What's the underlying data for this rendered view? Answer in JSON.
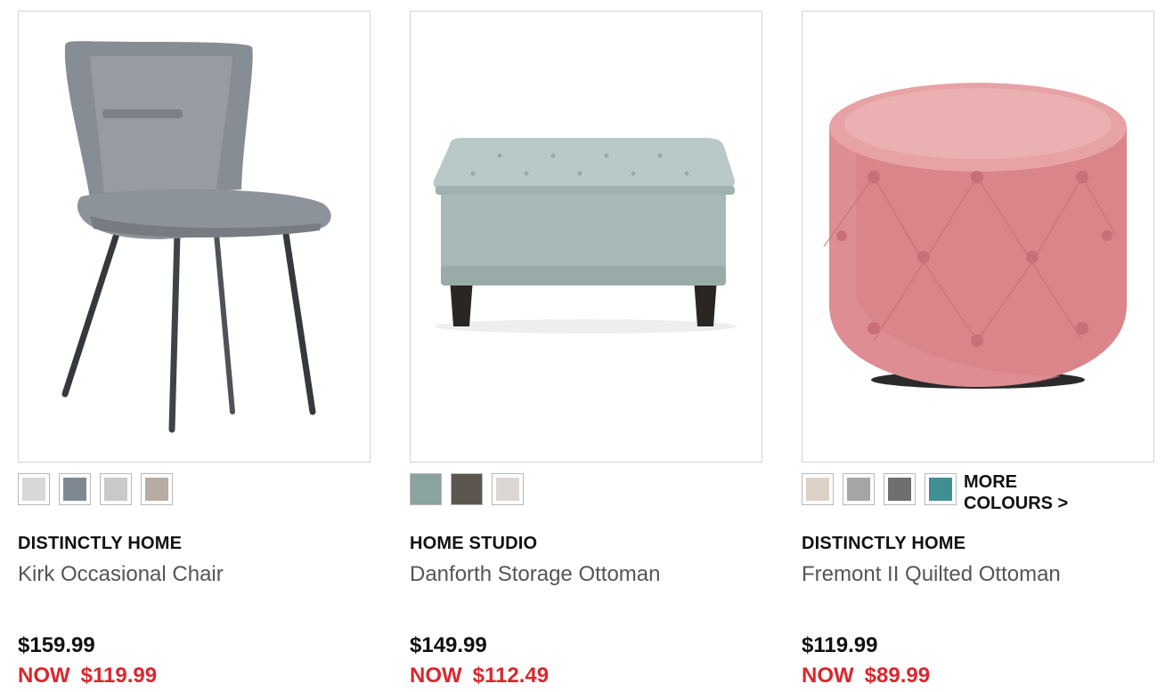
{
  "products": [
    {
      "brand": "DISTINCTLY HOME",
      "name": "Kirk Occasional Chair",
      "price": "$159.99",
      "now_label": "NOW",
      "sale_price": "$119.99",
      "image_icon": "grey-dining-chair",
      "swatches": [
        "#d8d8d8",
        "#7e8892",
        "#c9cac8",
        "#b7aca4"
      ],
      "more_colours": ""
    },
    {
      "brand": "HOME STUDIO",
      "name": "Danforth Storage Ottoman",
      "price": "$149.99",
      "now_label": "NOW",
      "sale_price": "$112.49",
      "image_icon": "mint-storage-ottoman",
      "swatches": [
        "#8aa3a0",
        "#5d564e",
        "#dcd6d2"
      ],
      "more_colours": ""
    },
    {
      "brand": "DISTINCTLY HOME",
      "name": "Fremont II Quilted Ottoman",
      "price": "$119.99",
      "now_label": "NOW",
      "sale_price": "$89.99",
      "image_icon": "pink-round-ottoman",
      "swatches": [
        "#ddd2c5",
        "#a5a5a5",
        "#6f6f70",
        "#3f8f93"
      ],
      "more_colours": "MORE\nCOLOURS >"
    }
  ],
  "colors": {
    "sale": "#d8282f",
    "name": "#555555",
    "brand": "#111111"
  }
}
